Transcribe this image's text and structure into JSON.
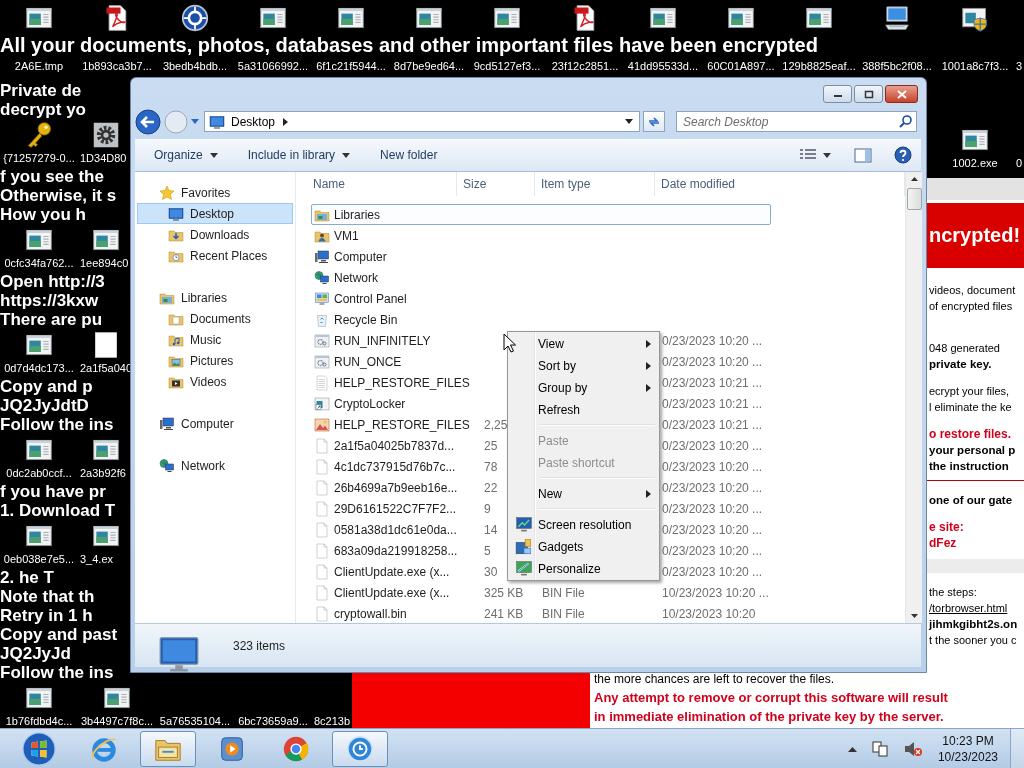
{
  "desktop": {
    "top_row": [
      {
        "label": "2A6E.tmp",
        "kind": "program",
        "clipped": false
      },
      {
        "label": "1b893ca3b7...",
        "kind": "pdf",
        "clipped": false
      },
      {
        "label": "3bedb4bdb...",
        "kind": "round",
        "clipped": false
      },
      {
        "label": "5a31066992...",
        "kind": "program",
        "clipped": false
      },
      {
        "label": "6f1c21f5944...",
        "kind": "program",
        "clipped": false
      },
      {
        "label": "8d7be9ed64...",
        "kind": "program",
        "clipped": false
      },
      {
        "label": "9cd5127ef3...",
        "kind": "program",
        "clipped": false
      },
      {
        "label": "23f12c2851...",
        "kind": "pdf",
        "clipped": false
      },
      {
        "label": "41dd95533d...",
        "kind": "program",
        "clipped": false
      },
      {
        "label": "60C01A897...",
        "kind": "program",
        "clipped": false
      },
      {
        "label": "129b8825eaf...",
        "kind": "program",
        "clipped": false
      },
      {
        "label": "388f5bc2f08...",
        "kind": "computer",
        "clipped": false
      },
      {
        "label": "1001a8c7f3...",
        "kind": "shield",
        "clipped": false
      },
      {
        "label": "3",
        "clipped": true
      }
    ],
    "banner": "All your documents, photos, databases and other important files have been encrypted",
    "left_strip": [
      {
        "kind": "text",
        "lines": [
          "Private de",
          "decrypt yo"
        ]
      },
      {
        "kind": "icons",
        "items": [
          {
            "label": "{71257279-0...",
            "kind": "key",
            "clipped": false
          },
          {
            "label": "1D34D80",
            "kind": "gear",
            "clipped": true
          }
        ]
      },
      {
        "kind": "text",
        "lines": [
          "f you see the",
          "Otherwise, it s",
          "How you h"
        ]
      },
      {
        "kind": "icons",
        "items": [
          {
            "label": "0cfc34fa762...",
            "kind": "program",
            "clipped": false
          },
          {
            "label": "1ee894c0",
            "kind": "program",
            "clipped": true
          }
        ]
      },
      {
        "kind": "text",
        "lines": [
          "Open http://3",
          "https://3kxw",
          "There are pu"
        ]
      },
      {
        "kind": "icons",
        "items": [
          {
            "label": "0d7d4dc173...",
            "kind": "program",
            "clipped": false
          },
          {
            "label": "2a1f5a040",
            "kind": "page",
            "clipped": true
          }
        ]
      },
      {
        "kind": "text",
        "lines": [
          "Copy and p",
          "JQ2JyJdtD",
          "Follow the ins"
        ]
      },
      {
        "kind": "icons",
        "items": [
          {
            "label": "0dc2ab0ccf...",
            "kind": "program",
            "clipped": false
          },
          {
            "label": "2a3b92f6",
            "kind": "program",
            "clipped": true
          }
        ]
      },
      {
        "kind": "text",
        "lines": [
          "f you have pr",
          "1. Download T"
        ]
      },
      {
        "kind": "icons",
        "items": [
          {
            "label": "0eb038e7e5...",
            "kind": "program",
            "clipped": false
          },
          {
            "label": "3_4.ex",
            "kind": "program",
            "clipped": true
          }
        ]
      },
      {
        "kind": "text",
        "lines": [
          "2. he T",
          "Note that th",
          "Retry in 1 h",
          "Copy and past",
          "JQ2JyJd",
          "Follow the ins"
        ]
      },
      {
        "kind": "icons",
        "items": [
          {
            "label": "1b76fdbd4c...",
            "kind": "program",
            "clipped": false
          },
          {
            "label": "3b4497c7f8c...",
            "kind": "program",
            "clipped": false
          },
          {
            "label": "5a76535104...",
            "clipped": false
          },
          {
            "label": "6bc73659a9...",
            "clipped": false
          },
          {
            "label": "8c213b",
            "clipped": true
          }
        ]
      }
    ],
    "right_row": [
      {
        "label": "1002.exe",
        "kind": "program",
        "clipped": false
      },
      {
        "label": "0",
        "clipped": true
      }
    ]
  },
  "ransom_window": {
    "header": "ncrypted!",
    "blocks": [
      {
        "kind": "text",
        "lines": [
          {
            "text": "videos, document",
            "kind": "plain"
          },
          {
            "text": "of encrypted files",
            "kind": "plain"
          }
        ]
      },
      {
        "kind": "text",
        "lines": [
          {
            "text": "048 generated",
            "kind": "plain"
          },
          {
            "text": "private key.",
            "kind": "strong"
          }
        ]
      },
      {
        "kind": "text",
        "lines": [
          {
            "text": "ecrypt your files,",
            "kind": "plain"
          },
          {
            "text": "l eliminate the ke",
            "kind": "plain"
          }
        ]
      },
      {
        "kind": "text",
        "lines": [
          {
            "text": "o restore files.",
            "kind": "warning"
          },
          {
            "text": "your personal p",
            "kind": "strong"
          },
          {
            "text": "the instruction",
            "kind": "strong"
          }
        ]
      },
      {
        "kind": "rule"
      },
      {
        "kind": "text",
        "lines": [
          {
            "text": "one of our gate",
            "kind": "strong"
          }
        ]
      },
      {
        "kind": "text",
        "lines": [
          {
            "text": "e site:",
            "kind": "warning"
          },
          {
            "text": "dFez",
            "kind": "warning"
          }
        ]
      },
      {
        "kind": "band"
      },
      {
        "kind": "text",
        "lines": [
          {
            "text": "the steps:",
            "kind": "plain"
          },
          {
            "text": "/torbrowser.html",
            "kind": "link"
          },
          {
            "text": "jihmkgibht2s.on",
            "kind": "strong"
          },
          {
            "text": "t the sooner you c",
            "kind": "plain"
          }
        ]
      }
    ],
    "bottom_lines": [
      {
        "text": "the more chances are left to recover the files.",
        "kind": "plain"
      },
      {
        "text": "Any attempt to remove or corrupt this software will result",
        "kind": "warning"
      },
      {
        "text": "in immediate elimination of the private key by the server.",
        "kind": "warning"
      }
    ]
  },
  "explorer": {
    "address": "Desktop",
    "search": {
      "placeholder": "Search Desktop"
    },
    "toolbar": [
      {
        "label": "Organize",
        "dropdown": true
      },
      {
        "label": "Include in library",
        "dropdown": true
      },
      {
        "label": "New folder",
        "dropdown": false
      }
    ],
    "nav": [
      {
        "label": "Favorites",
        "kind": "star",
        "selected": false,
        "children": [
          {
            "label": "Desktop",
            "kind": "desktop",
            "selected": true
          },
          {
            "label": "Downloads",
            "kind": "downloads",
            "selected": false
          },
          {
            "label": "Recent Places",
            "kind": "recent",
            "selected": false
          }
        ]
      },
      {
        "label": "Libraries",
        "kind": "libraries",
        "selected": false,
        "children": [
          {
            "label": "Documents",
            "kind": "documents",
            "selected": false
          },
          {
            "label": "Music",
            "kind": "music",
            "selected": false
          },
          {
            "label": "Pictures",
            "kind": "pictures",
            "selected": false
          },
          {
            "label": "Videos",
            "kind": "videos",
            "selected": false
          }
        ]
      },
      {
        "label": "Computer",
        "kind": "computer-small",
        "selected": false
      },
      {
        "label": "Network",
        "kind": "network",
        "selected": false
      }
    ],
    "columns": [
      "Name",
      "Size",
      "Item type",
      "Date modified"
    ],
    "rows": [
      {
        "name": "Libraries",
        "kind": "libraries",
        "selected": true
      },
      {
        "name": "VM1",
        "kind": "userfolder",
        "selected": false
      },
      {
        "name": "Computer",
        "kind": "computer-small",
        "selected": false
      },
      {
        "name": "Network",
        "kind": "network",
        "selected": false
      },
      {
        "name": "Control Panel",
        "kind": "controlpanel",
        "selected": false
      },
      {
        "name": "Recycle Bin",
        "kind": "recycle",
        "selected": false
      },
      {
        "name": "RUN_INFINITELY",
        "kind": "script",
        "date": "0/23/2023 10:20 ...",
        "selected": false
      },
      {
        "name": "RUN_ONCE",
        "kind": "script",
        "date": "0/23/2023 10:20 ...",
        "selected": false
      },
      {
        "name": "HELP_RESTORE_FILES",
        "kind": "text",
        "date": "0/23/2023 10:21 ...",
        "selected": false
      },
      {
        "name": "CryptoLocker",
        "kind": "shortcut",
        "date": "0/23/2023 10:21 ...",
        "selected": false
      },
      {
        "name": "HELP_RESTORE_FILES",
        "kind": "html",
        "size": "2,25",
        "date": "0/23/2023 10:21 ...",
        "selected": false
      },
      {
        "name": "2a1f5a04025b7837d...",
        "kind": "file",
        "size": "25",
        "date": "0/23/2023 10:20 ...",
        "selected": false
      },
      {
        "name": "4c1dc737915d76b7c...",
        "kind": "file",
        "size": "78",
        "date": "0/23/2023 10:20 ...",
        "selected": false
      },
      {
        "name": "26b4699a7b9eeb16e...",
        "kind": "file",
        "size": "22",
        "date": "0/23/2023 10:20 ...",
        "selected": false
      },
      {
        "name": "29D6161522C7F7F2...",
        "kind": "file",
        "size": "9",
        "date": "0/23/2023 10:20 ...",
        "selected": false
      },
      {
        "name": "0581a38d1dc61e0da...",
        "kind": "file",
        "size": "14",
        "date": "0/23/2023 10:20 ...",
        "selected": false
      },
      {
        "name": "683a09da219918258...",
        "kind": "file",
        "size": "5",
        "date": "0/23/2023 10:20 ...",
        "selected": false
      },
      {
        "name": "ClientUpdate.exe (x...",
        "kind": "file",
        "size": "30",
        "date": "0/23/2023 10:20 ...",
        "selected": false
      },
      {
        "name": "ClientUpdate.exe (x...",
        "kind": "file",
        "size": "325 KB",
        "type": "BIN File",
        "date": "10/23/2023 10:20 ...",
        "selected": false
      },
      {
        "name": "cryptowall.bin",
        "kind": "file",
        "size": "241 KB",
        "type": "BIN File",
        "date": "10/23/2023 10:20",
        "selected": false
      }
    ],
    "status": "323 items"
  },
  "context_menu": {
    "groups": [
      [
        {
          "label": "View",
          "submenu": true,
          "disabled": false
        },
        {
          "label": "Sort by",
          "submenu": true,
          "disabled": false
        },
        {
          "label": "Group by",
          "submenu": true,
          "disabled": false
        },
        {
          "label": "Refresh",
          "submenu": false,
          "disabled": false
        }
      ],
      [
        {
          "label": "Paste",
          "submenu": false,
          "disabled": true
        },
        {
          "label": "Paste shortcut",
          "submenu": false,
          "disabled": true
        }
      ],
      [
        {
          "label": "New",
          "submenu": true,
          "disabled": false
        }
      ],
      [
        {
          "label": "Screen resolution",
          "submenu": false,
          "disabled": false,
          "kind": "screen"
        },
        {
          "label": "Gadgets",
          "submenu": false,
          "disabled": false,
          "kind": "gadgets"
        },
        {
          "label": "Personalize",
          "submenu": false,
          "disabled": false,
          "kind": "personalize"
        }
      ]
    ]
  },
  "taskbar": {
    "apps": [
      {
        "kind": "ie",
        "active": false
      },
      {
        "kind": "folders",
        "active": true
      },
      {
        "kind": "media",
        "active": false
      },
      {
        "kind": "browser",
        "active": false
      },
      {
        "kind": "clock",
        "active": true
      }
    ],
    "volume_muted": true,
    "time": "10:23 PM",
    "date": "10/23/2023"
  }
}
